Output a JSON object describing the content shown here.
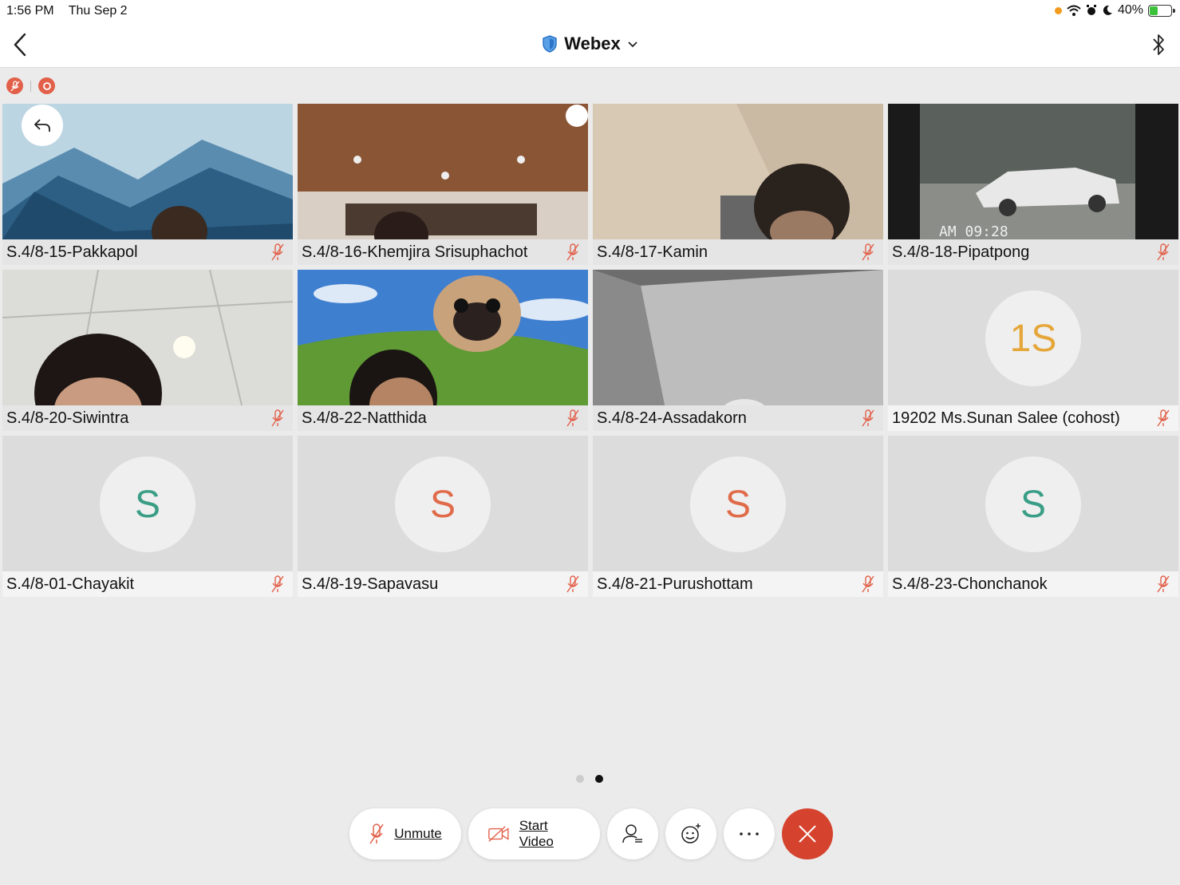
{
  "status": {
    "time": "1:56 PM",
    "date": "Thu Sep 2",
    "battery": "40%",
    "battery_level": 0.4
  },
  "header": {
    "title": "Webex",
    "icons": [
      "back-icon",
      "shield-icon",
      "chevron-down-icon",
      "bluetooth-icon"
    ]
  },
  "colors": {
    "accent": "#d5432f",
    "mic_off": "#e2604a",
    "green_avatar": "#3a9e86",
    "orange_avatar": "#e06b4a",
    "gold_avatar": "#e5a63a"
  },
  "participants": [
    {
      "name": "S.4/8-15-Pakkapol"
    },
    {
      "name": "S.4/8-16-Khemjira Srisuphachot"
    },
    {
      "name": "S.4/8-17-Kamin"
    },
    {
      "name": "S.4/8-18-Pipatpong"
    },
    {
      "name": "S.4/8-20-Siwintra"
    },
    {
      "name": "S.4/8-22-Natthida"
    },
    {
      "name": "S.4/8-24-Assadakorn"
    },
    {
      "name": "19202 Ms.Sunan Salee (cohost)",
      "initials": "1S"
    },
    {
      "name": "S.4/8-01-Chayakit",
      "initials": "S"
    },
    {
      "name": "S.4/8-19-Sapavasu",
      "initials": "S"
    },
    {
      "name": "S.4/8-21-Purushottam",
      "initials": "S"
    },
    {
      "name": "S.4/8-23-Chonchanok",
      "initials": "S"
    }
  ],
  "video_overlay_text": "AM 09:28",
  "pager": {
    "pages": 2,
    "current": 2
  },
  "controls": {
    "unmute": "Unmute",
    "start_video": "Start Video"
  }
}
